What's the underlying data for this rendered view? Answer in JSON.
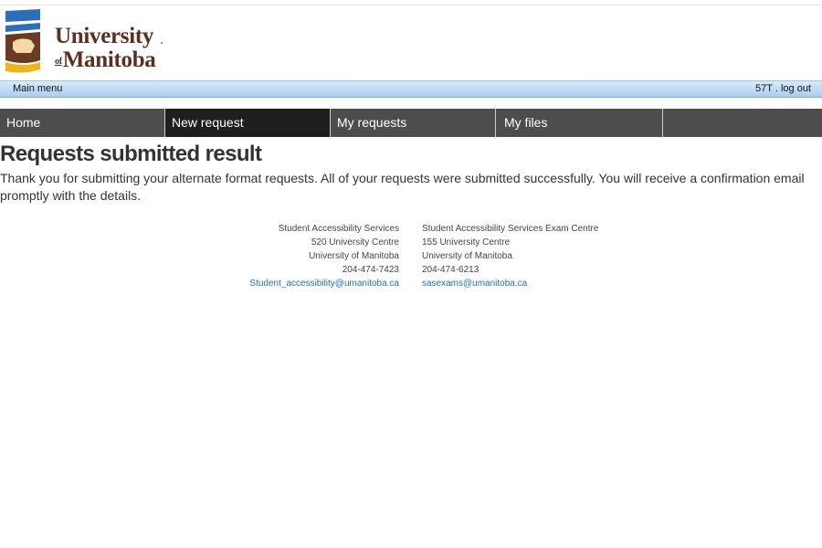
{
  "logo": {
    "line1": "University",
    "of": "of",
    "line2": "Manitoba",
    "colors": {
      "brown": "#5b2e1f",
      "blue": "#2c6fb7",
      "gold": "#f0b41c"
    }
  },
  "menubar": {
    "main_menu_label": "Main menu",
    "user_id": "57T",
    "separator": " . ",
    "logout_label": "log out"
  },
  "nav": {
    "tabs": [
      {
        "label": "Home"
      },
      {
        "label": "New request"
      },
      {
        "label": "My requests"
      },
      {
        "label": "My files"
      },
      {
        "label": ""
      }
    ],
    "active_tab": "New request"
  },
  "main": {
    "title": "Requests submitted result",
    "message": "Thank you for submitting your alternate format requests. All of your requests were submitted successfully. You will receive a confirmation email promptly with the details."
  },
  "contacts": {
    "left": {
      "name": "Student Accessibility Services",
      "address": "520 University Centre",
      "institution": "University of Manitoba",
      "phone": "204-474-7423",
      "email": "Student_accessibility@umanitoba.ca"
    },
    "right": {
      "name": "Student Accessibility Services Exam Centre",
      "address": "155 University Centre",
      "institution": "University of Manitoba",
      "phone": "204-474-6213",
      "email": "sasexams@umanitoba.ca"
    }
  }
}
